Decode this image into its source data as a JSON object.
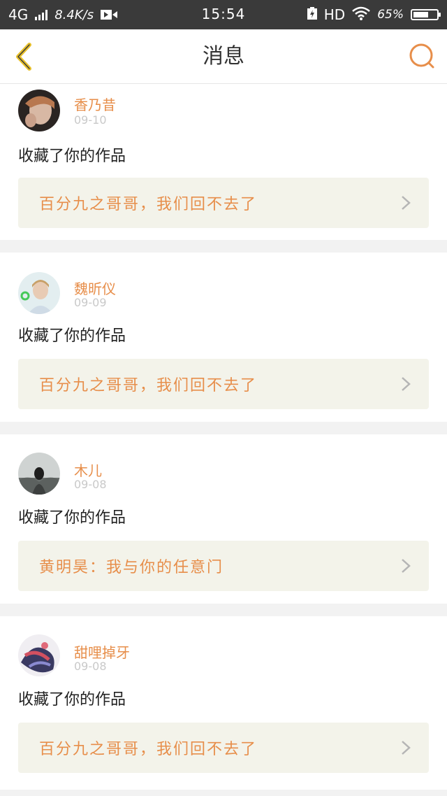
{
  "status_bar": {
    "network": "4G",
    "speed": "8.4K/s",
    "time": "15:54",
    "hd": "HD",
    "battery": "65%",
    "battery_level": 0.65
  },
  "header": {
    "title": "消息"
  },
  "colors": {
    "accent": "#e78e4a",
    "back_arrow": "#e8c02a",
    "card_link_bg": "#f3f3ea"
  },
  "messages": [
    {
      "name": "香乃昔",
      "date": "09-10",
      "action": "收藏了你的作品",
      "work_title": "百分九之哥哥，我们回不去了"
    },
    {
      "name": "魏昕仪",
      "date": "09-09",
      "action": "收藏了你的作品",
      "work_title": "百分九之哥哥，我们回不去了"
    },
    {
      "name": "木儿",
      "date": "09-08",
      "action": "收藏了你的作品",
      "work_title": "黄明昊：我与你的任意门"
    },
    {
      "name": "甜哩掉牙",
      "date": "09-08",
      "action": "收藏了你的作品",
      "work_title": "百分九之哥哥，我们回不去了"
    }
  ]
}
